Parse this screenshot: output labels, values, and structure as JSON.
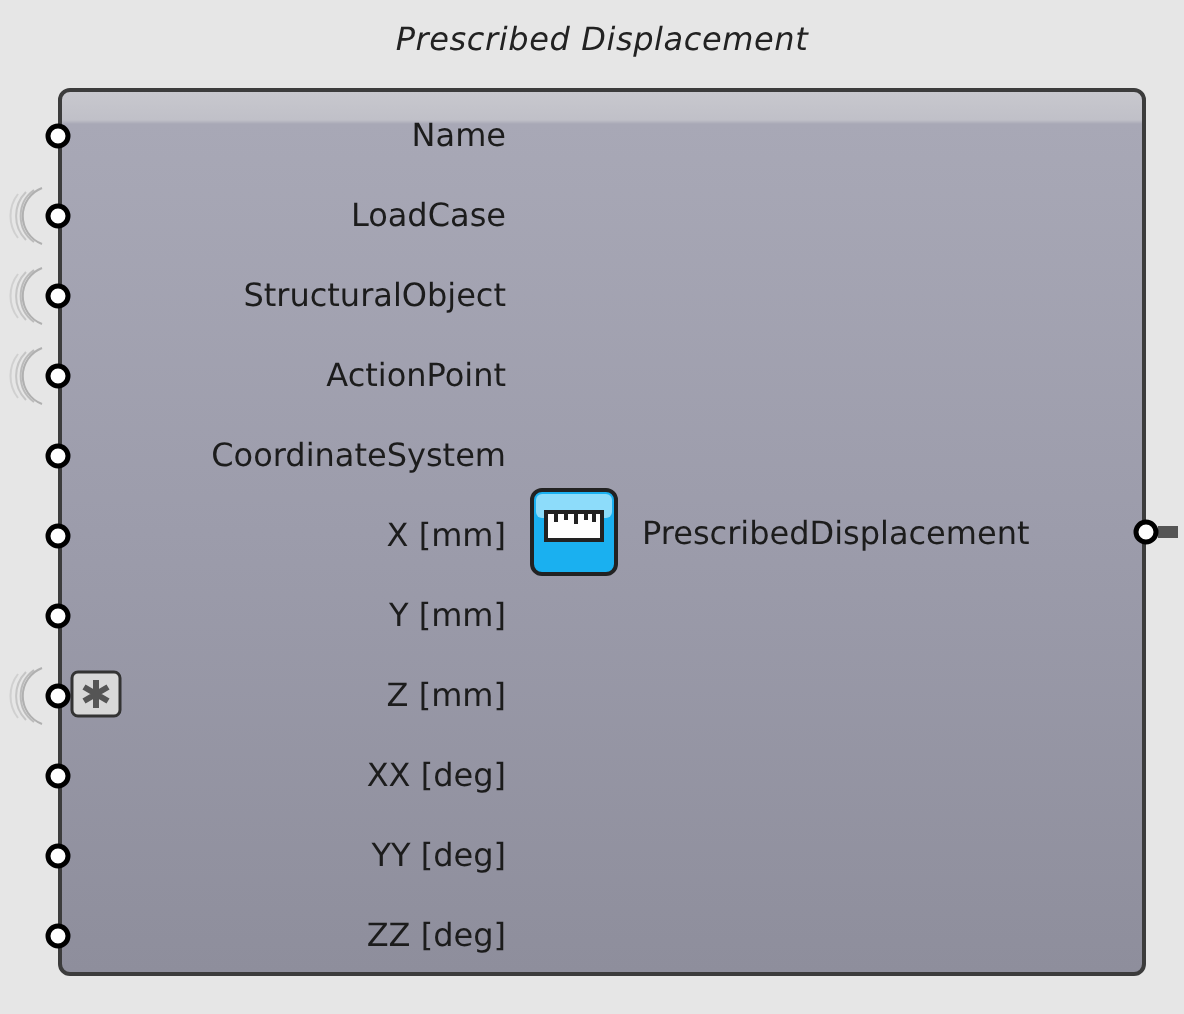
{
  "component": {
    "title": "Prescribed Displacement",
    "inputs": [
      {
        "label": "Name",
        "list_access": false,
        "marked": false
      },
      {
        "label": "LoadCase",
        "list_access": true,
        "marked": false
      },
      {
        "label": "StructuralObject",
        "list_access": true,
        "marked": false
      },
      {
        "label": "ActionPoint",
        "list_access": true,
        "marked": false
      },
      {
        "label": "CoordinateSystem",
        "list_access": false,
        "marked": false
      },
      {
        "label": "X [mm]",
        "list_access": false,
        "marked": false
      },
      {
        "label": "Y [mm]",
        "list_access": false,
        "marked": false
      },
      {
        "label": "Z [mm]",
        "list_access": true,
        "marked": true
      },
      {
        "label": "XX [deg]",
        "list_access": false,
        "marked": false
      },
      {
        "label": "YY [deg]",
        "list_access": false,
        "marked": false
      },
      {
        "label": "ZZ [deg]",
        "list_access": false,
        "marked": false
      }
    ],
    "output": {
      "label": "PrescribedDisplacement"
    }
  }
}
